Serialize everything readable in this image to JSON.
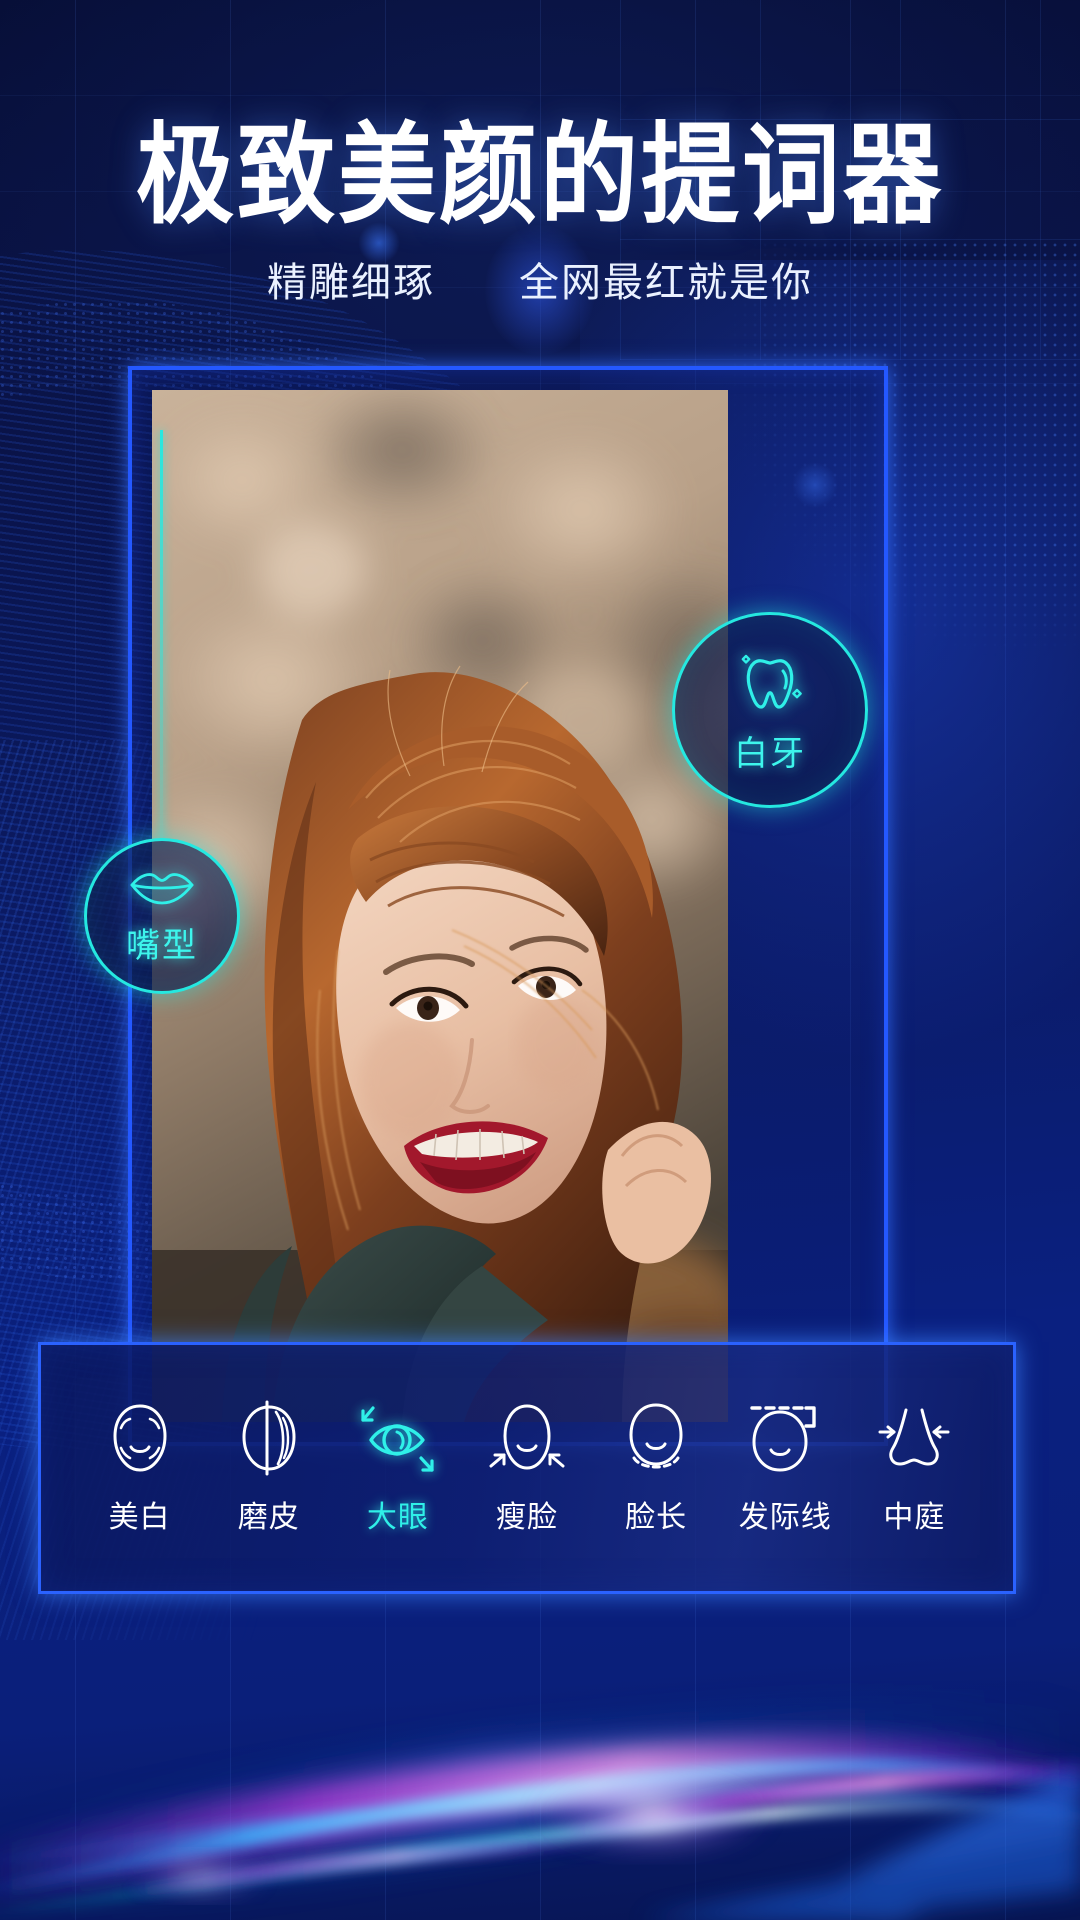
{
  "header": {
    "title": "极致美颜的提词器",
    "subtitle": "精雕细琢　　全网最红就是你"
  },
  "colors": {
    "accent_cyan": "#2ff0e8",
    "accent_blue": "#2a62ff",
    "frame_blue": "#2458ff",
    "bg_navy": "#0a1348",
    "text_white": "#ffffff"
  },
  "badges": [
    {
      "id": "teeth",
      "label": "白牙",
      "icon": "tooth-icon"
    },
    {
      "id": "mouth",
      "label": "嘴型",
      "icon": "lips-icon"
    }
  ],
  "toolbar": {
    "items": [
      {
        "label": "美白",
        "icon": "face-whiten-icon",
        "active": false
      },
      {
        "label": "磨皮",
        "icon": "skin-smooth-icon",
        "active": false
      },
      {
        "label": "大眼",
        "icon": "big-eye-icon",
        "active": true
      },
      {
        "label": "瘦脸",
        "icon": "slim-face-icon",
        "active": false
      },
      {
        "label": "脸长",
        "icon": "face-length-icon",
        "active": false
      },
      {
        "label": "发际线",
        "icon": "hairline-icon",
        "active": false
      },
      {
        "label": "中庭",
        "icon": "nose-midface-icon",
        "active": false
      }
    ]
  }
}
